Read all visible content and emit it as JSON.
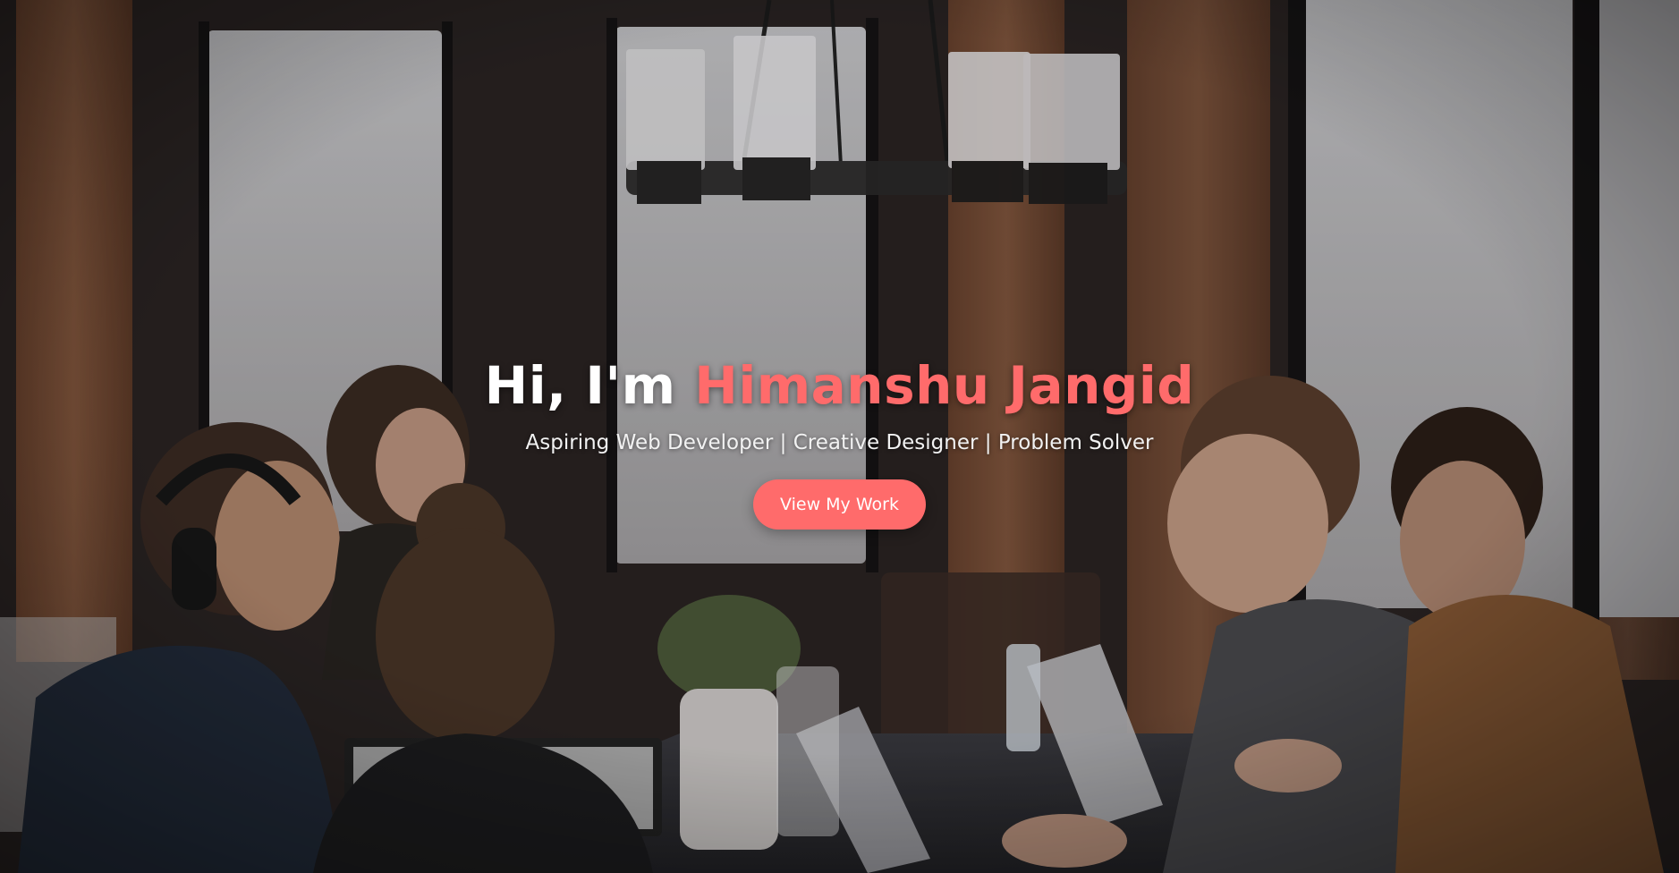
{
  "hero": {
    "greeting": "Hi, I'm ",
    "name": "Himanshu Jangid",
    "tagline": "Aspiring Web Developer | Creative Designer | Problem Solver",
    "cta_label": "View My Work"
  },
  "colors": {
    "accent": "#ff6b6b",
    "text": "#ffffff"
  }
}
